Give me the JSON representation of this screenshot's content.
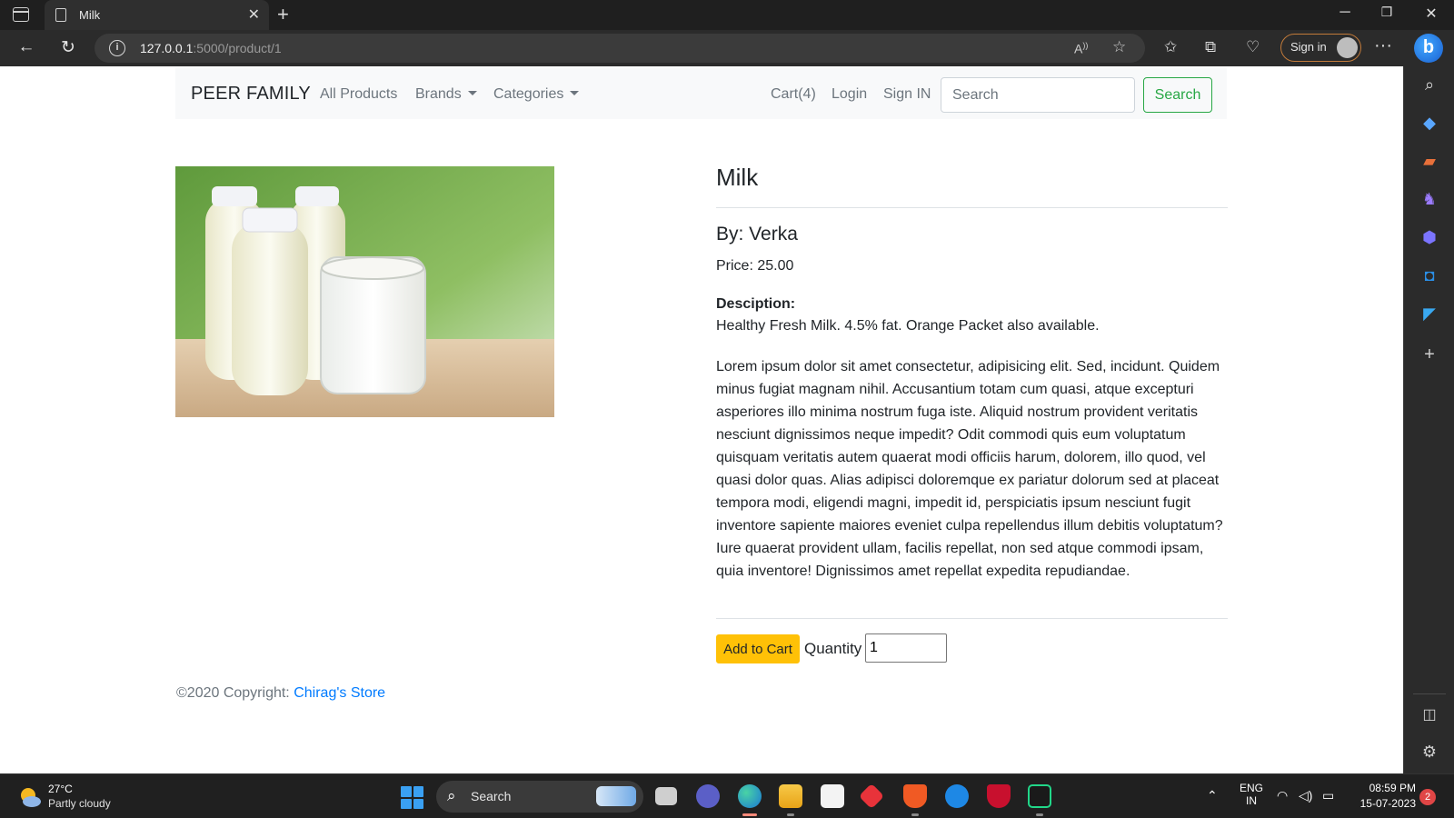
{
  "browser": {
    "tab_title": "Milk",
    "url_host": "127.0.0.1",
    "url_path": ":5000/product/1",
    "signin_label": "Sign in"
  },
  "navbar": {
    "brand": "PEER FAMILY",
    "links": [
      "All Products",
      "Brands",
      "Categories"
    ],
    "right_links": [
      "Cart(4)",
      "Login",
      "Sign IN"
    ],
    "search_placeholder": "Search",
    "search_button": "Search"
  },
  "product": {
    "title": "Milk",
    "by_line": "By: Verka",
    "price_line": "Price: 25.00",
    "description_label": "Desciption:",
    "description": "Healthy Fresh Milk. 4.5% fat. Orange Packet also available.",
    "long_text": "Lorem ipsum dolor sit amet consectetur, adipisicing elit. Sed, incidunt. Quidem minus fugiat magnam nihil. Accusantium totam cum quasi, atque excepturi asperiores illo minima nostrum fuga iste. Aliquid nostrum provident veritatis nesciunt dignissimos neque impedit? Odit commodi quis eum voluptatum quisquam veritatis autem quaerat modi officiis harum, dolorem, illo quod, vel quasi dolor quas. Alias adipisci doloremque ex pariatur dolorum sed at placeat tempora modi, eligendi magni, impedit id, perspiciatis ipsum nesciunt fugit inventore sapiente maiores eveniet culpa repellendus illum debitis voluptatum? Iure quaerat provident ullam, facilis repellat, non sed atque commodi ipsam, quia inventore! Dignissimos amet repellat expedita repudiandae.",
    "add_to_cart": "Add to Cart",
    "quantity_label": "Quantity",
    "quantity_value": "1"
  },
  "footer": {
    "copyright": "©2020 Copyright: ",
    "store_link": "Chirag's Store"
  },
  "taskbar": {
    "weather_temp": "27°C",
    "weather_desc": "Partly cloudy",
    "search_label": "Search",
    "lang_top": "ENG",
    "lang_bottom": "IN",
    "time": "08:59 PM",
    "date": "15-07-2023",
    "notification_count": "2"
  },
  "colors": {
    "brand_success": "#28a745",
    "warning": "#ffc107",
    "link": "#007bff",
    "navbar_bg": "#f8f9fa"
  }
}
